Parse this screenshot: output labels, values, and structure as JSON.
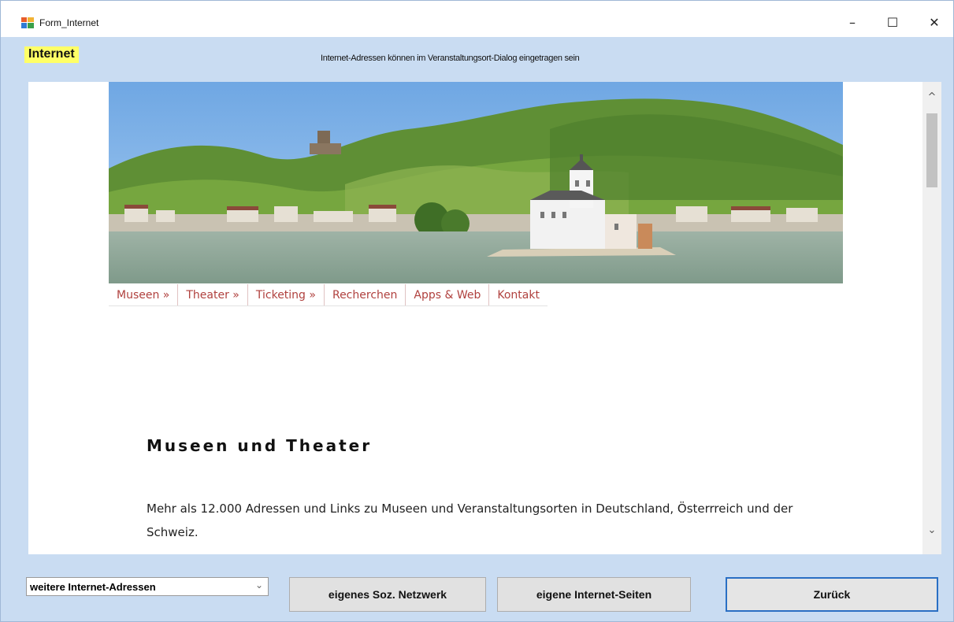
{
  "window": {
    "title": "Form_Internet",
    "minimize_glyph": "–",
    "maximize_glyph": "☐",
    "close_glyph": "✕"
  },
  "header": {
    "badge": "Internet",
    "hint": "Internet-Adressen können im Veranstaltungsort-Dialog  eingetragen sein"
  },
  "web": {
    "nav": [
      {
        "label": "Museen »"
      },
      {
        "label": "Theater »"
      },
      {
        "label": "Ticketing »"
      },
      {
        "label": "Recherchen"
      },
      {
        "label": "Apps & Web"
      },
      {
        "label": "Kontakt"
      }
    ],
    "heading": "Museen und Theater",
    "body": "Mehr als 12.000 Adressen und Links zu Museen und Veranstaltungsorten in Deutschland, Österrreich und der Schweiz."
  },
  "scrollbar": {
    "up": "^",
    "down": "⌄"
  },
  "footer": {
    "combo_value": "weitere Internet-Adressen",
    "combo_arrow": "⌄",
    "btn_soz": "eigenes Soz. Netzwerk",
    "btn_seiten": "eigene Internet-Seiten",
    "btn_zurueck": "Zurück"
  },
  "colors": {
    "badge_bg": "#ffff66",
    "nav_link": "#b0413e",
    "form_bg": "#c9dcf2",
    "focus_border": "#2a6fc4"
  },
  "icons": {
    "app": "form-app-icon",
    "scroll_up": "chevron-up-icon",
    "scroll_down": "chevron-down-icon",
    "combo": "chevron-down-icon"
  }
}
